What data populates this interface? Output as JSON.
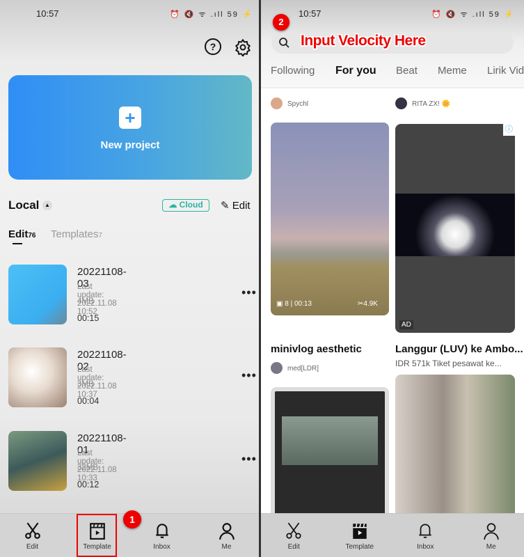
{
  "left": {
    "status": {
      "time": "10:57",
      "icons": "⏰ 🔇 ᯤ .ıll 59 ⚡"
    },
    "header_icons": [
      "help-icon",
      "settings-icon"
    ],
    "new_project": {
      "label": "New project",
      "icon": "plus-icon"
    },
    "local": {
      "title": "Local",
      "cloud_label": "Cloud",
      "edit_label": "Edit"
    },
    "tabs": [
      {
        "label": "Edit",
        "count": "76",
        "active": true
      },
      {
        "label": "Templates",
        "count": "7",
        "active": false
      }
    ],
    "projects": [
      {
        "title": "20221108-03",
        "updated": "Last update: 2022.11.08 10:52",
        "size": "4MB",
        "duration": "00:15"
      },
      {
        "title": "20221108-02",
        "updated": "Last update: 2022.11.08 10:37",
        "size": "3MB",
        "duration": "00:04"
      },
      {
        "title": "20221108-01",
        "updated": "Last update: 2022.11.08 10:33",
        "size": "32MB",
        "duration": "00:12"
      }
    ],
    "nav": [
      {
        "label": "Edit",
        "icon": "scissors-icon"
      },
      {
        "label": "Template",
        "icon": "clapper-icon"
      },
      {
        "label": "Inbox",
        "icon": "bell-icon"
      },
      {
        "label": "Me",
        "icon": "person-icon"
      }
    ],
    "step_badge": "1"
  },
  "right": {
    "status": {
      "time": "10:57",
      "icons": "⏰ 🔇 ᯤ .ıll 59 ⚡"
    },
    "step_badge": "2",
    "search": {
      "placeholder": "",
      "annotation": "Input Velocity Here"
    },
    "tabs": [
      "Following",
      "For you",
      "Beat",
      "Meme",
      "Lirik Vid"
    ],
    "active_tab": "For you",
    "feed": [
      {
        "author": "Spychl",
        "title": "minivlog aesthetic",
        "clips": "8",
        "duration": "00:13",
        "uses": "4.9K",
        "sub_author": "med[LDR]"
      },
      {
        "author": "RITA ZX! 🌼",
        "title": "Langgur (LUV) ke Ambo...",
        "subtitle": "IDR 571k Tiket pesawat ke...",
        "ad": "AD"
      }
    ],
    "nav": [
      {
        "label": "Edit",
        "icon": "scissors-icon"
      },
      {
        "label": "Template",
        "icon": "clapper-filled-icon"
      },
      {
        "label": "Inbox",
        "icon": "bell-icon"
      },
      {
        "label": "Me",
        "icon": "person-icon"
      }
    ]
  },
  "colors": {
    "accent_blue": "#2f8ef6",
    "cloud_teal": "#2bb5a0",
    "annotation_red": "#e00000"
  }
}
